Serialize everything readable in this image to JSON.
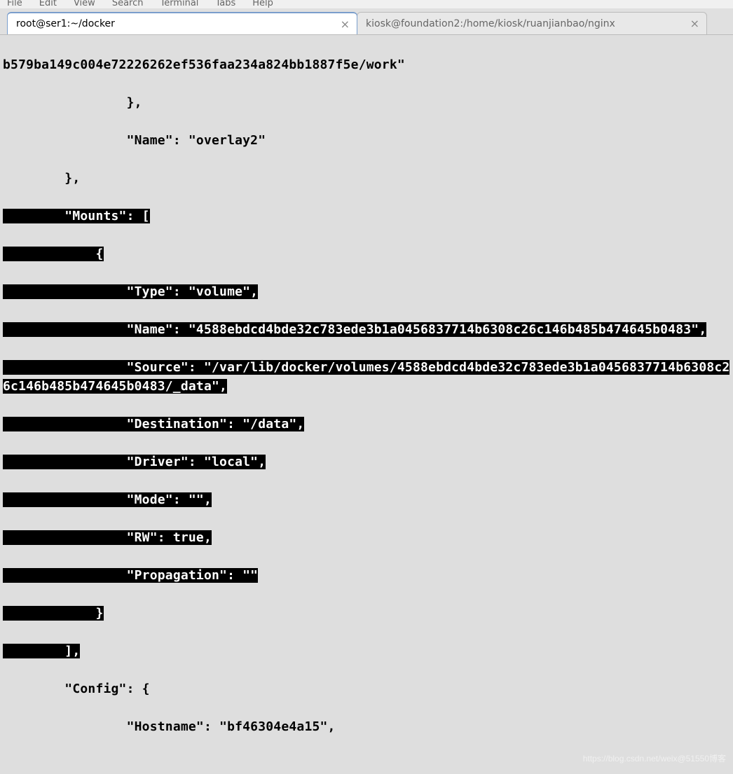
{
  "menubar": {
    "items": [
      "File",
      "Edit",
      "View",
      "Search",
      "Terminal",
      "Tabs",
      "Help"
    ]
  },
  "tabs": [
    {
      "label": "root@ser1:~/docker",
      "active": true
    },
    {
      "label": "kiosk@foundation2:/home/kiosk/ruanjianbao/nginx",
      "active": false
    }
  ],
  "terminal": {
    "line0": "b579ba149c004e72226262ef536faa234a824bb1887f5e/work\"",
    "line1": "                },",
    "line2": "                \"Name\": \"overlay2\"",
    "line3_pre": "        },",
    "sel_l1": "        \"Mounts\": [",
    "sel_l2": "            {",
    "sel_l3": "                \"Type\": \"volume\",",
    "sel_l4": "                \"Name\": \"4588ebdcd4bde32c783ede3b1a0456837714b6308c26c146b485b474645b0483\",",
    "sel_l5": "                \"Source\": \"/var/lib/docker/volumes/4588ebdcd4bde32c783ede3b1a0456837714b6308c26c146b485b474645b0483/_data\",",
    "sel_l6": "                \"Destination\": \"/data\",",
    "sel_l7": "                \"Driver\": \"local\",",
    "sel_l8": "                \"Mode\": \"\",",
    "sel_l9": "                \"RW\": true,",
    "sel_l10": "                \"Propagation\": \"\"",
    "sel_l11": "            }",
    "sel_l12": "        ],",
    "line_cfg": "        \"Config\": {",
    "line_host": "                \"Hostname\": \"bf46304e4a15\","
  },
  "watermark": "https://blog.csdn.net/weix@51550博客"
}
